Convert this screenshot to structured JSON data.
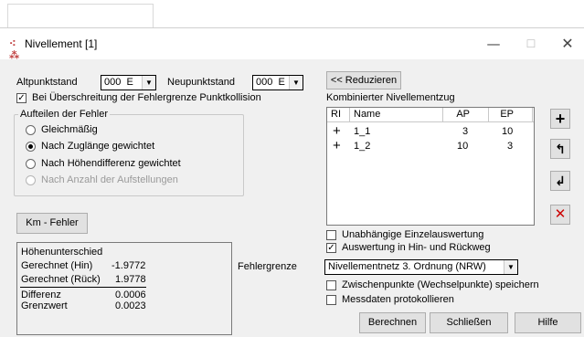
{
  "window": {
    "title": "Nivellement [1]",
    "title_icon": "survey-level-icon",
    "minimize": "—",
    "maximize": "☐",
    "close": "✕"
  },
  "altpunktstand": {
    "label": "Altpunktstand",
    "value": "000",
    "value_tail": "E"
  },
  "neupunktstand": {
    "label": "Neupunktstand",
    "value": "000",
    "value_tail": "E"
  },
  "collision_checkbox": {
    "label": "Bei Überschreitung der Fehlergrenze Punktkollision",
    "checked": true
  },
  "error_group": {
    "legend": "Aufteilen der Fehler",
    "options": [
      {
        "label": "Gleichmäßig",
        "selected": false,
        "enabled": true
      },
      {
        "label": "Nach Zuglänge gewichtet",
        "selected": true,
        "enabled": true
      },
      {
        "label": "Nach Höhendifferenz gewichtet",
        "selected": false,
        "enabled": true
      },
      {
        "label": "Nach Anzahl der Aufstellungen",
        "selected": false,
        "enabled": false
      }
    ]
  },
  "km_fehler_button": "Km - Fehler",
  "hoehen": {
    "title": "Höhenunterschied",
    "rows": [
      {
        "label": "Gerechnet (Hin)",
        "value": "-1.9772"
      },
      {
        "label": "Gerechnet (Rück)",
        "value": "1.9778"
      },
      {
        "label": "Differenz",
        "value": "0.0006"
      },
      {
        "label": "Grenzwert",
        "value": "0.0023"
      }
    ]
  },
  "reduzieren_button": "<< Reduzieren",
  "kombinierter": {
    "label": "Kombinierter Nivellementzug",
    "columns": [
      "RI",
      "Name",
      "AP",
      "EP"
    ],
    "rows": [
      {
        "ri": "+",
        "name": "1_1",
        "ap": "3",
        "ep": "10"
      },
      {
        "ri": "+",
        "name": "1_2",
        "ap": "10",
        "ep": "3"
      }
    ]
  },
  "side_tools": [
    {
      "name": "add-icon",
      "glyph": "+",
      "color": "#000000"
    },
    {
      "name": "move-up-icon",
      "glyph": "⬑",
      "color": "#000000"
    },
    {
      "name": "move-down-icon",
      "glyph": "⬐",
      "color": "#000000"
    },
    {
      "name": "delete-icon",
      "glyph": "✕",
      "color": "#cc0000"
    }
  ],
  "unabhaengige": {
    "label": "Unabhängige Einzelauswertung",
    "checked": false
  },
  "hin_rueck": {
    "label": "Auswertung in Hin- und Rückweg",
    "checked": true
  },
  "fehlergrenze": {
    "label": "Fehlergrenze",
    "value": "Nivellementnetz 3. Ordnung (NRW)"
  },
  "zwischenpunkte": {
    "label": "Zwischenpunkte (Wechselpunkte) speichern",
    "checked": false
  },
  "messdaten": {
    "label": "Messdaten protokollieren",
    "checked": false
  },
  "footer": {
    "berechnen": "Berechnen",
    "schliessen": "Schließen",
    "hilfe": "Hilfe"
  }
}
